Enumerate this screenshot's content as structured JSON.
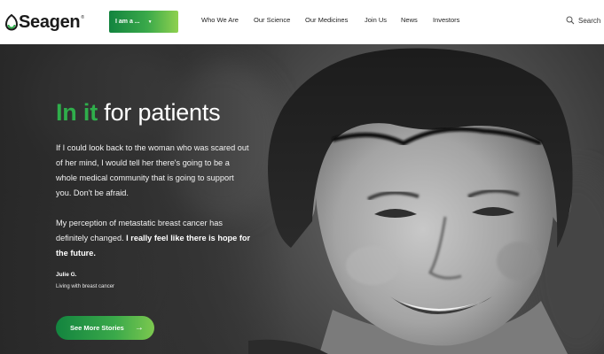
{
  "brand": {
    "name": "Seagen",
    "registered": "®"
  },
  "audience_selector": {
    "label": "I am a ...",
    "caret": "▼"
  },
  "nav": {
    "items": [
      {
        "label": "Who We Are"
      },
      {
        "label": "Our Science"
      },
      {
        "label": "Our Medicines"
      },
      {
        "label": "Join Us"
      },
      {
        "label": "News"
      },
      {
        "label": "Investors"
      }
    ]
  },
  "search": {
    "label": "Search"
  },
  "hero": {
    "headline_accent": "In it",
    "headline_rest": " for patients",
    "paragraph1": "If I could look back to the woman who was scared out of her mind, I would tell her there's going to be a whole medical community that is going to support you. Don't be afraid.",
    "paragraph2_plain": "My perception of metastatic breast cancer has definitely changed. ",
    "paragraph2_bold": "I really feel like there is hope for the future.",
    "attribution_name": "Julie G.",
    "attribution_desc": "Living with breast cancer",
    "cta_label": "See More Stories",
    "cta_arrow": "→"
  },
  "colors": {
    "brand_green": "#2fae4b",
    "dark_green": "#13843f",
    "light_green": "#8fd14f"
  }
}
